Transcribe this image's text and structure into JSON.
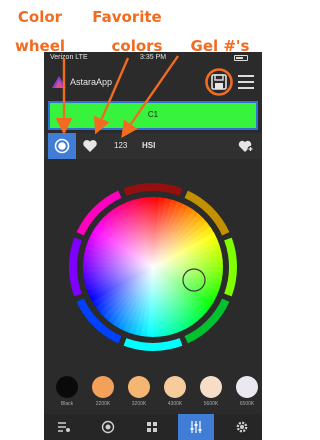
{
  "annotations": {
    "wheel_line1": "Color",
    "wheel_line2": "wheel",
    "favorite_line1": "Favorite",
    "favorite_line2": "colors",
    "gel_label": "Gel #'s",
    "color": "#f26b21"
  },
  "statusbar": {
    "carrier": "Verizon LTE",
    "time": "3:35 PM"
  },
  "app": {
    "title": "AstaraApp"
  },
  "current_color": {
    "label": "C1",
    "color": "#37f33e"
  },
  "tabs": {
    "gel_label": "123",
    "hsi_label": "HSI"
  },
  "swatches": [
    {
      "label": "Black",
      "color": "#0a0a0a"
    },
    {
      "label": "2200K",
      "color": "#f2a05a"
    },
    {
      "label": "3200K",
      "color": "#f5b673"
    },
    {
      "label": "4300K",
      "color": "#f7cc9c"
    },
    {
      "label": "5600K",
      "color": "#f6ddc8"
    },
    {
      "label": "6500K",
      "color": "#ece8f2"
    }
  ],
  "icons": [
    "color-wheel-icon",
    "heart-icon",
    "heart-plus-icon",
    "save-icon",
    "menu-icon",
    "cue-list-icon",
    "effects-icon",
    "grid-icon",
    "faders-icon",
    "settings-icon"
  ]
}
